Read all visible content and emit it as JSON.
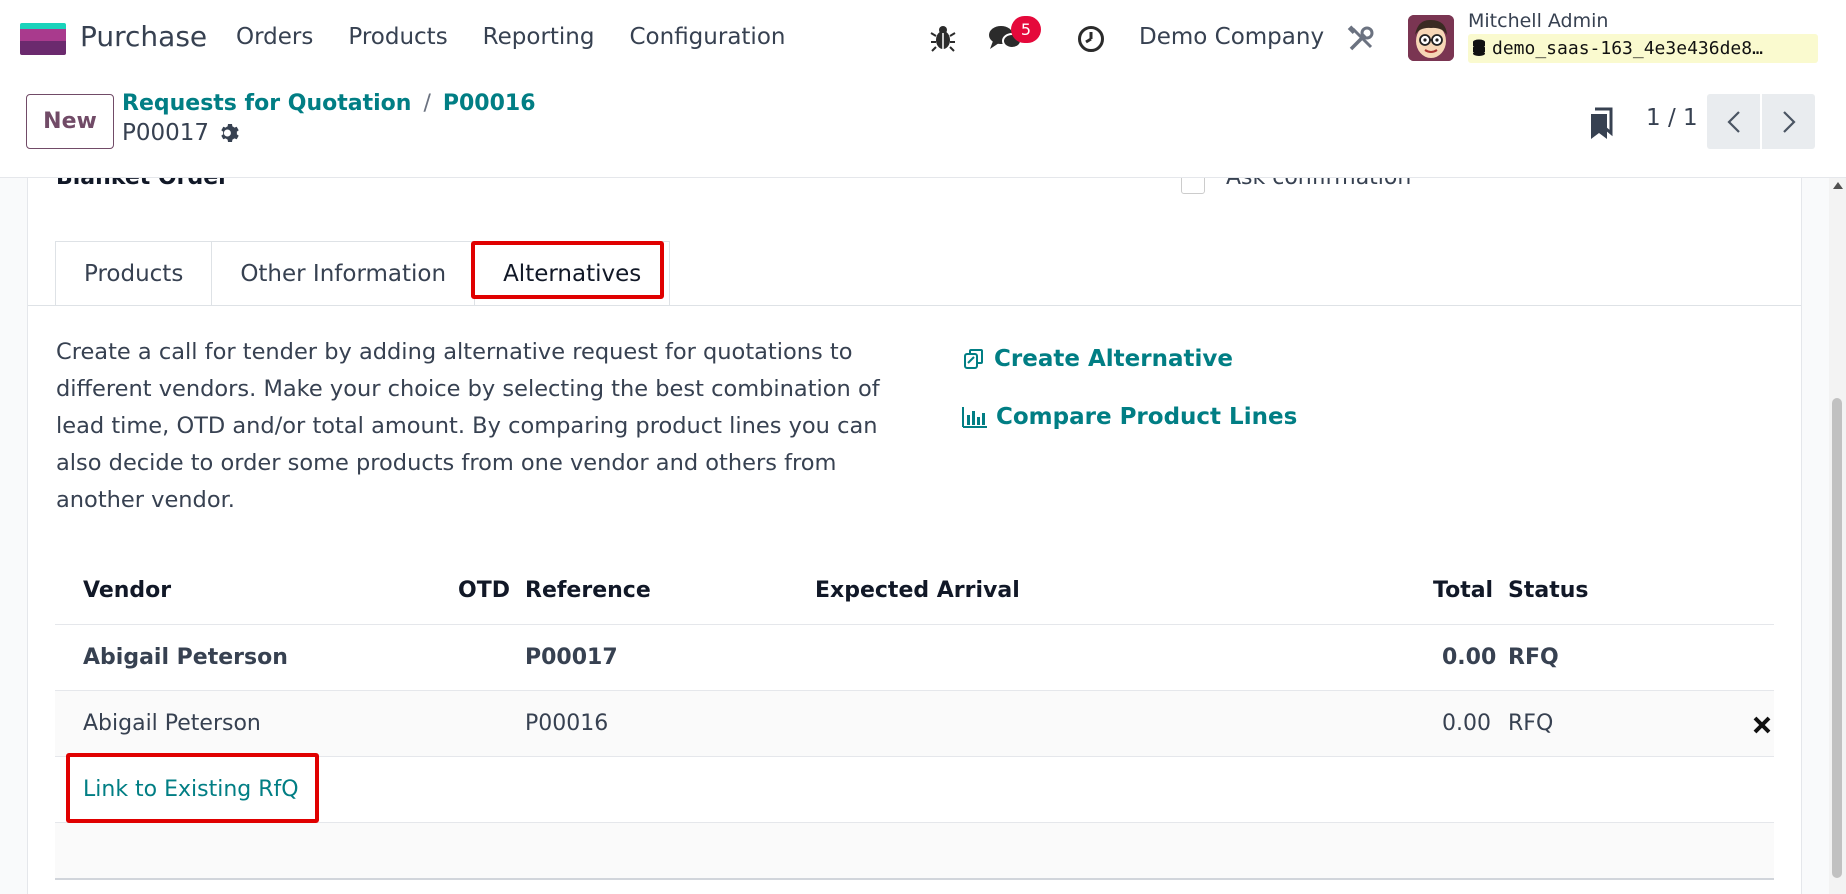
{
  "navbar": {
    "app_name": "Purchase",
    "menu": [
      "Orders",
      "Products",
      "Reporting",
      "Configuration"
    ],
    "chat_count": "5",
    "company": "Demo Company",
    "user_name": "Mitchell Admin",
    "database": "demo_saas-163_4e3e436de8…"
  },
  "control": {
    "new_label": "New",
    "breadcrumb": [
      "Requests for Quotation",
      "P00016"
    ],
    "breadcrumb_sep": "/",
    "record": "P00017",
    "pager": "1 / 1"
  },
  "form": {
    "partial_field_label": "Blanket Order",
    "partial_checkbox_label": "Ask confirmation",
    "tabs": [
      "Products",
      "Other Information",
      "Alternatives"
    ],
    "active_tab": "Alternatives",
    "help_text": "Create a call for tender by adding alternative request for quotations to different vendors. Make your choice by selecting the best combination of lead time, OTD and/or total amount. By comparing product lines you can also decide to order some products from one vendor and others from another vendor.",
    "create_alternative": "Create Alternative",
    "compare_lines": "Compare Product Lines",
    "table": {
      "headers": [
        "Vendor",
        "OTD",
        "Reference",
        "Expected Arrival",
        "Total",
        "Status"
      ],
      "rows": [
        {
          "vendor": "Abigail Peterson",
          "otd": "",
          "reference": "P00017",
          "expected_arrival": "",
          "total": "0.00",
          "status": "RFQ"
        },
        {
          "vendor": "Abigail Peterson",
          "otd": "",
          "reference": "P00016",
          "expected_arrival": "",
          "total": "0.00",
          "status": "RFQ"
        }
      ],
      "link_existing": "Link to Existing RfQ"
    }
  },
  "colors": {
    "brand": "#714b67",
    "link": "#017e84",
    "highlight": "#e00000",
    "badge": "#e5093b"
  }
}
